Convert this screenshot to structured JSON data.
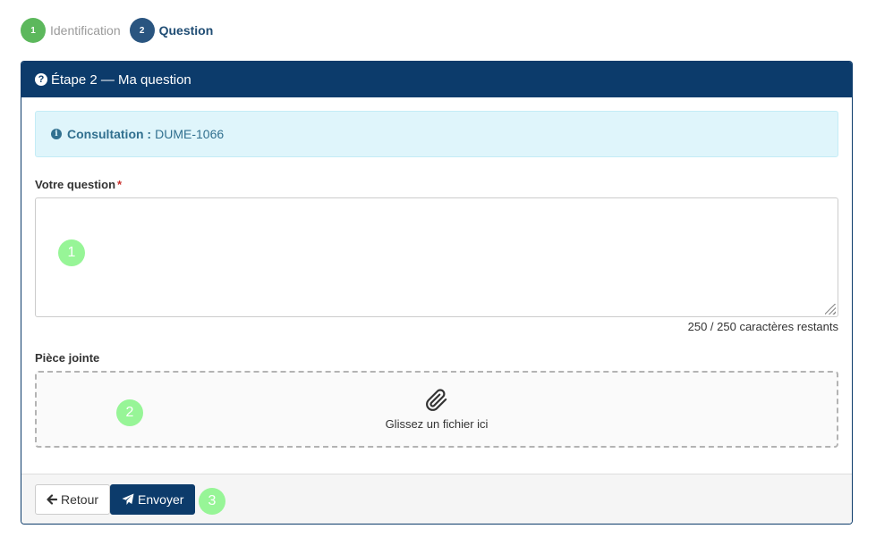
{
  "stepper": {
    "steps": [
      {
        "number": "1",
        "label": "Identification",
        "state": "done"
      },
      {
        "number": "2",
        "label": "Question",
        "state": "active"
      }
    ]
  },
  "panel": {
    "title": "Étape 2 — Ma question"
  },
  "alert": {
    "label": "Consultation :",
    "value": "DUME-1066"
  },
  "question": {
    "label": "Votre question",
    "required_mark": "*",
    "value": "",
    "char_count": "250 / 250 caractères restants"
  },
  "attachment": {
    "label": "Pièce jointe",
    "drop_text": "Glissez un fichier ici"
  },
  "footer": {
    "back_label": "Retour",
    "send_label": "Envoyer"
  },
  "markers": [
    "1",
    "2",
    "3"
  ],
  "colors": {
    "primary": "#0c3b6b",
    "success": "#5cb85c",
    "info_bg": "#dff5fb",
    "info_text": "#31708f",
    "marker": "#97f597"
  }
}
